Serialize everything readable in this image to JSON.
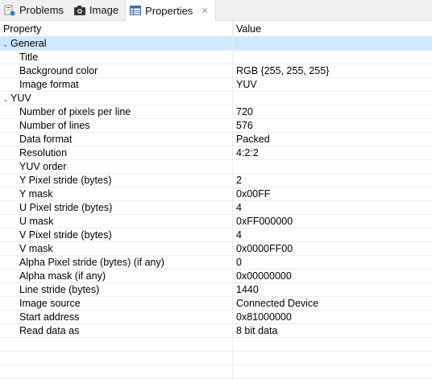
{
  "tabs": [
    {
      "label": "Problems",
      "icon": "problems-icon"
    },
    {
      "label": "Image",
      "icon": "camera-icon"
    },
    {
      "label": "Properties",
      "icon": "properties-icon",
      "active": true
    }
  ],
  "table": {
    "headers": {
      "property": "Property",
      "value": "Value"
    },
    "groups": [
      {
        "name": "General",
        "selected": true,
        "rows": [
          {
            "property": "Title",
            "value": ""
          },
          {
            "property": "Background color",
            "value": "RGB {255, 255, 255}"
          },
          {
            "property": "Image format",
            "value": "YUV"
          }
        ]
      },
      {
        "name": "YUV",
        "rows": [
          {
            "property": "Number of pixels per line",
            "value": "720"
          },
          {
            "property": "Number of lines",
            "value": "576"
          },
          {
            "property": "Data format",
            "value": "Packed"
          },
          {
            "property": "Resolution",
            "value": "4:2:2"
          },
          {
            "property": "YUV order",
            "value": ""
          },
          {
            "property": "Y Pixel stride (bytes)",
            "value": "2"
          },
          {
            "property": "Y mask",
            "value": "0x00FF"
          },
          {
            "property": "U Pixel stride (bytes)",
            "value": "4"
          },
          {
            "property": "U mask",
            "value": "0xFF000000"
          },
          {
            "property": "V Pixel stride (bytes)",
            "value": "4"
          },
          {
            "property": "V mask",
            "value": "0x0000FF00"
          },
          {
            "property": "Alpha Pixel stride (bytes) (if any)",
            "value": "0"
          },
          {
            "property": "Alpha mask (if any)",
            "value": "0x00000000"
          },
          {
            "property": "Line stride (bytes)",
            "value": "1440"
          },
          {
            "property": "Image source",
            "value": "Connected Device"
          },
          {
            "property": "Start address",
            "value": "0x81000000"
          },
          {
            "property": "Read data as",
            "value": "8 bit data"
          }
        ]
      }
    ]
  },
  "colors": {
    "selection": "#cde8ff",
    "tabbar": "#f0f0f0"
  }
}
